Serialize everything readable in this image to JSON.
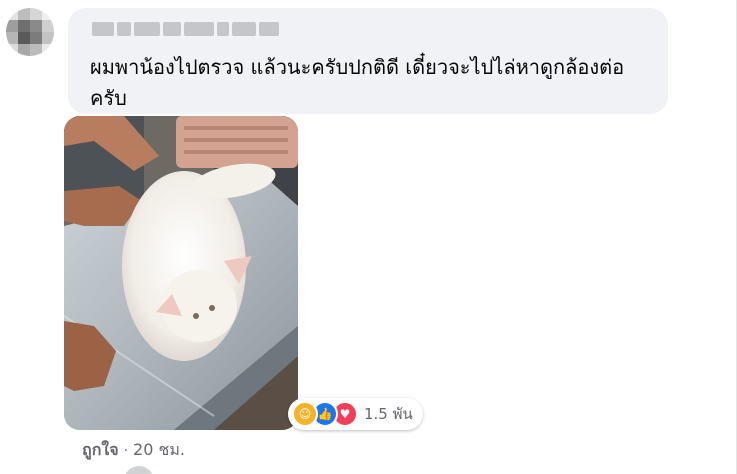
{
  "comment": {
    "text": "ผมพาน้องไปตรวจ แล้วนะครับปกติดี เดี๋ยวจะไปไล่หาดูกล้องต่อครับ"
  },
  "photo": {
    "subject": "white long-haired cat on steel veterinary exam table"
  },
  "reactions": {
    "icons": [
      "care-icon",
      "like-icon",
      "love-icon"
    ],
    "count": "1.5 พัน"
  },
  "actions": {
    "like_label": "ถูกใจ",
    "separator": "·",
    "time": "20 ชม."
  },
  "colors": {
    "bubble_bg": "#f0f2f5",
    "text": "#050505",
    "meta_text": "#65676b",
    "like_blue": "#1877f2",
    "love_red": "#f33e58",
    "care_yellow": "#f7b125"
  }
}
